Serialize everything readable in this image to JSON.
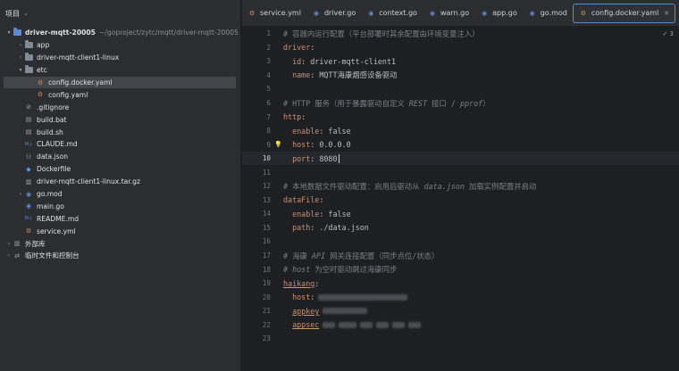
{
  "project_panel": {
    "title": "项目",
    "tree": [
      {
        "label": "driver-mqtt-20005",
        "path": "~/goproject/zytc/mqtt/driver-mqtt-20005",
        "indent": 0,
        "arrow": "▾",
        "icon": "folder-module-icon",
        "bold": true
      },
      {
        "label": "app",
        "indent": 1,
        "arrow": "›",
        "icon": "folder-icon"
      },
      {
        "label": "driver-mqtt-client1-linux",
        "indent": 1,
        "arrow": "›",
        "icon": "folder-icon"
      },
      {
        "label": "etc",
        "indent": 1,
        "arrow": "▾",
        "icon": "folder-icon"
      },
      {
        "label": "config.docker.yaml",
        "indent": 2,
        "arrow": "",
        "icon": "yaml-icon",
        "selected": true
      },
      {
        "label": "config.yaml",
        "indent": 2,
        "arrow": "",
        "icon": "yaml-icon"
      },
      {
        "label": ".gitignore",
        "indent": 1,
        "arrow": "",
        "icon": "gitignore-icon"
      },
      {
        "label": "build.bat",
        "indent": 1,
        "arrow": "",
        "icon": "script-icon"
      },
      {
        "label": "build.sh",
        "indent": 1,
        "arrow": "",
        "icon": "script-icon"
      },
      {
        "label": "CLAUDE.md",
        "indent": 1,
        "arrow": "",
        "icon": "markdown-icon"
      },
      {
        "label": "data.json",
        "indent": 1,
        "arrow": "",
        "icon": "json-icon"
      },
      {
        "label": "Dockerfile",
        "indent": 1,
        "arrow": "",
        "icon": "docker-icon"
      },
      {
        "label": "driver-mqtt-client1-linux.tar.gz",
        "indent": 1,
        "arrow": "",
        "icon": "archive-icon"
      },
      {
        "label": "go.mod",
        "indent": 1,
        "arrow": "›",
        "icon": "gomod-icon"
      },
      {
        "label": "main.go",
        "indent": 1,
        "arrow": "",
        "icon": "go-file-icon"
      },
      {
        "label": "README.md",
        "indent": 1,
        "arrow": "",
        "icon": "markdown-icon"
      },
      {
        "label": "service.yml",
        "indent": 1,
        "arrow": "",
        "icon": "yaml-icon"
      },
      {
        "label": "外部库",
        "indent": 0,
        "arrow": "›",
        "icon": "library-icon"
      },
      {
        "label": "临时文件和控制台",
        "indent": 0,
        "arrow": "›",
        "icon": "scratch-icon"
      }
    ]
  },
  "tabs": [
    {
      "label": "service.yml",
      "icon": "yaml-icon"
    },
    {
      "label": "driver.go",
      "icon": "go-file-icon"
    },
    {
      "label": "context.go",
      "icon": "go-file-icon"
    },
    {
      "label": "warn.go",
      "icon": "go-file-icon"
    },
    {
      "label": "app.go",
      "icon": "go-file-icon"
    },
    {
      "label": "go.mod",
      "icon": "gomod-icon"
    },
    {
      "label": "config.docker.yaml",
      "icon": "yaml-icon",
      "active": true
    }
  ],
  "editor": {
    "inspection_count": "3",
    "current_line": 10,
    "lines": [
      [
        {
          "t": "# 容器内运行配置（平台部署时其余配置由环境变量注入）",
          "c": "cmt"
        }
      ],
      [
        {
          "t": "driver",
          "c": "key"
        },
        {
          "t": ":",
          "c": "val"
        }
      ],
      [
        {
          "t": "  id",
          "c": "key"
        },
        {
          "t": ": driver-mqtt-client1",
          "c": "val"
        }
      ],
      [
        {
          "t": "  name",
          "c": "key"
        },
        {
          "t": ": MQTT海康烟感设备驱动",
          "c": "val"
        }
      ],
      [],
      [
        {
          "t": "# HTTP 服务（用于暴露驱动自定义 ",
          "c": "cmt"
        },
        {
          "t": "REST",
          "c": "cmti"
        },
        {
          "t": " 接口 / ",
          "c": "cmt"
        },
        {
          "t": "pprof",
          "c": "cmti"
        },
        {
          "t": "）",
          "c": "cmt"
        }
      ],
      [
        {
          "t": "http",
          "c": "key"
        },
        {
          "t": ":",
          "c": "val"
        }
      ],
      [
        {
          "t": "  enable",
          "c": "key"
        },
        {
          "t": ": false",
          "c": "val"
        }
      ],
      [
        {
          "t": "  host",
          "c": "key",
          "bulb": true
        },
        {
          "t": ": 0.0.0.0",
          "c": "val"
        }
      ],
      [
        {
          "t": "  port",
          "c": "key"
        },
        {
          "t": ": 8080",
          "c": "val",
          "caret": true
        }
      ],
      [],
      [
        {
          "t": "# 本地数据文件驱动配置：启用后驱动从 ",
          "c": "cmt"
        },
        {
          "t": "data.json",
          "c": "cmti"
        },
        {
          "t": " 加载实例配置并启动",
          "c": "cmt"
        }
      ],
      [
        {
          "t": "dataFile",
          "c": "key"
        },
        {
          "t": ":",
          "c": "val"
        }
      ],
      [
        {
          "t": "  enable",
          "c": "key"
        },
        {
          "t": ": false",
          "c": "val"
        }
      ],
      [
        {
          "t": "  path",
          "c": "key"
        },
        {
          "t": ": ./data.json",
          "c": "val"
        }
      ],
      [],
      [
        {
          "t": "# 海康 ",
          "c": "cmt"
        },
        {
          "t": "API",
          "c": "cmti"
        },
        {
          "t": " 网关连接配置（同步点位/状态）",
          "c": "cmt"
        }
      ],
      [
        {
          "t": "# ",
          "c": "cmt"
        },
        {
          "t": "host",
          "c": "cmti"
        },
        {
          "t": " 为空时驱动跳过海康同步",
          "c": "cmt"
        }
      ],
      [
        {
          "t": "haikang",
          "c": "key warn"
        },
        {
          "t": ":",
          "c": "val"
        }
      ],
      [
        {
          "t": "  host",
          "c": "key"
        },
        {
          "t": ":",
          "c": "val",
          "blur": [
            100
          ]
        }
      ],
      [
        {
          "t": "  ",
          "c": "val"
        },
        {
          "t": "appkey",
          "c": "key warn",
          "blur": [
            50
          ]
        }
      ],
      [
        {
          "t": "  ",
          "c": "val"
        },
        {
          "t": "appsec",
          "c": "key warn",
          "blur": [
            14,
            20,
            14,
            14,
            14,
            14
          ]
        }
      ],
      []
    ]
  },
  "colors": {
    "accent": "#4b8fe2",
    "panel": "#2b2d30",
    "editor_bg": "#1e1f22",
    "key": "#cf8e6d",
    "comment": "#7a7e85"
  }
}
